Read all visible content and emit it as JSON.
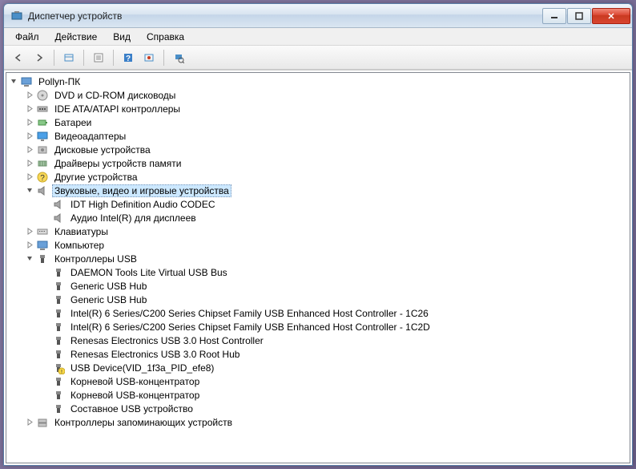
{
  "window": {
    "title": "Диспетчер устройств"
  },
  "menu": {
    "file": "Файл",
    "action": "Действие",
    "view": "Вид",
    "help": "Справка"
  },
  "tree": {
    "root": "Pollyn-ПК",
    "cat_dvd": "DVD и CD-ROM дисководы",
    "cat_ide": "IDE ATA/ATAPI контроллеры",
    "cat_battery": "Батареи",
    "cat_video": "Видеоадаптеры",
    "cat_disk": "Дисковые устройства",
    "cat_memdrivers": "Драйверы устройств памяти",
    "cat_other": "Другие устройства",
    "cat_sound": "Звуковые, видео и игровые устройства",
    "dev_idt": "IDT High Definition Audio CODEC",
    "dev_intelaudio": "Аудио Intel(R) для дисплеев",
    "cat_keyboard": "Клавиатуры",
    "cat_computer": "Компьютер",
    "cat_usb": "Контроллеры USB",
    "dev_daemon": "DAEMON Tools Lite Virtual USB Bus",
    "dev_generichub1": "Generic USB Hub",
    "dev_generichub2": "Generic USB Hub",
    "dev_intel1": "Intel(R) 6 Series/C200 Series Chipset Family USB Enhanced Host Controller - 1C26",
    "dev_intel2": "Intel(R) 6 Series/C200 Series Chipset Family USB Enhanced Host Controller - 1C2D",
    "dev_renesas1": "Renesas Electronics USB 3.0 Host Controller",
    "dev_renesas2": "Renesas Electronics USB 3.0 Root Hub",
    "dev_usbunknown": "USB Device(VID_1f3a_PID_efe8)",
    "dev_roothub1": "Корневой USB-концентратор",
    "dev_roothub2": "Корневой USB-концентратор",
    "dev_composite": "Составное USB устройство",
    "cat_storage": "Контроллеры запоминающих устройств"
  }
}
